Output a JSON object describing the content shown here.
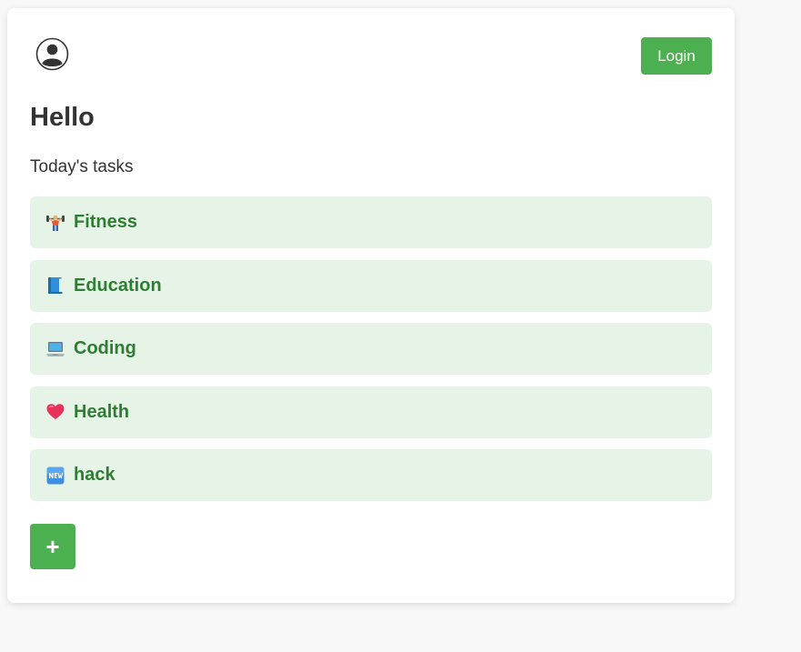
{
  "header": {
    "avatar_icon": "user-avatar-icon",
    "login_label": "Login"
  },
  "main": {
    "title": "Hello",
    "subtitle": "Today's tasks",
    "tasks": [
      {
        "label": "Fitness",
        "icon": "weightlifter-icon"
      },
      {
        "label": "Education",
        "icon": "book-icon"
      },
      {
        "label": "Coding",
        "icon": "laptop-icon"
      },
      {
        "label": "Health",
        "icon": "heart-icon"
      },
      {
        "label": "hack",
        "icon": "new-badge-icon"
      }
    ],
    "add_label": "+"
  },
  "colors": {
    "accent": "#4caf50",
    "task_bg": "#e6f4e8",
    "task_text": "#2e7d32",
    "heading_text": "#333333",
    "page_bg": "#f8f8f8"
  }
}
